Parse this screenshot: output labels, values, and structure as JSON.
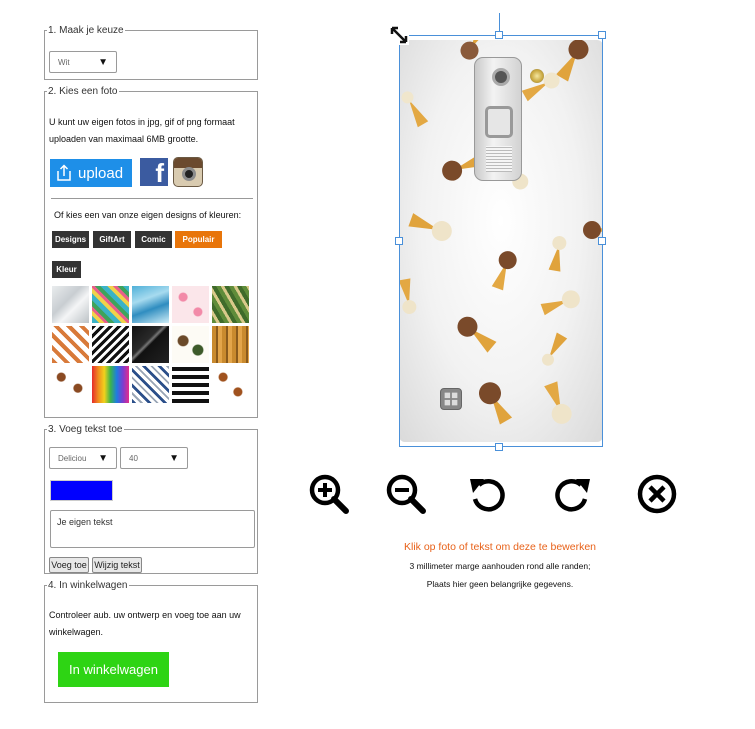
{
  "step1": {
    "legend": "1. Maak je keuze",
    "select_value": "Wit"
  },
  "step2": {
    "legend": "2. Kies een foto",
    "instructions": "U kunt uw eigen fotos in jpg, gif of png formaat uploaden van maximaal 6MB grootte.",
    "upload_label": "upload",
    "designs_prompt": "Of kies een van onze eigen designs of kleuren:",
    "tabs": [
      "Designs",
      "GiftArt",
      "Comic",
      "Populair",
      "Kleur"
    ],
    "active_tab": "Populair",
    "tiles": [
      {
        "name": "marble-white-tile"
      },
      {
        "name": "tropical-pineapple-tile"
      },
      {
        "name": "blue-marble-tile"
      },
      {
        "name": "flamingo-tile"
      },
      {
        "name": "palm-leaves-tile"
      },
      {
        "name": "hotdog-pattern-tile"
      },
      {
        "name": "zigzag-chevron-tile"
      },
      {
        "name": "black-marble-tile"
      },
      {
        "name": "autumn-leaves-tile"
      },
      {
        "name": "bamboo-tile"
      },
      {
        "name": "icecream-cones-tile"
      },
      {
        "name": "melting-crayons-tile"
      },
      {
        "name": "blue-chevron-tile"
      },
      {
        "name": "brush-stripes-tile"
      },
      {
        "name": "lips-pattern-tile"
      }
    ]
  },
  "step3": {
    "legend": "3. Voeg tekst toe",
    "font_value": "Deliciou",
    "size_value": "40",
    "text_color": "#0000ff",
    "text_placeholder": "Je eigen tekst",
    "add_label": "Voeg toe",
    "edit_label": "Wijzig tekst"
  },
  "step4": {
    "legend": "4. In winkelwagen",
    "instructions": "Controleer aub. uw ontwerp en voeg toe aan uw winkelwagen.",
    "cart_label": "In winkelwagen"
  },
  "editor": {
    "tools": [
      "zoom-in-icon",
      "zoom-out-icon",
      "rotate-left-icon",
      "rotate-right-icon",
      "delete-icon"
    ],
    "hint_click": "Klik op foto of tekst om deze te bewerken",
    "hint_margin": "3 millimeter marge aanhouden rond alle randen;",
    "hint_important": "Plaats hier geen belangrijke gegevens."
  },
  "colors": {
    "upload": "#1e8fe8",
    "cart": "#2ed414",
    "active_tab": "#e8750a",
    "hint": "#e8621a",
    "selection": "#4a90d9"
  }
}
